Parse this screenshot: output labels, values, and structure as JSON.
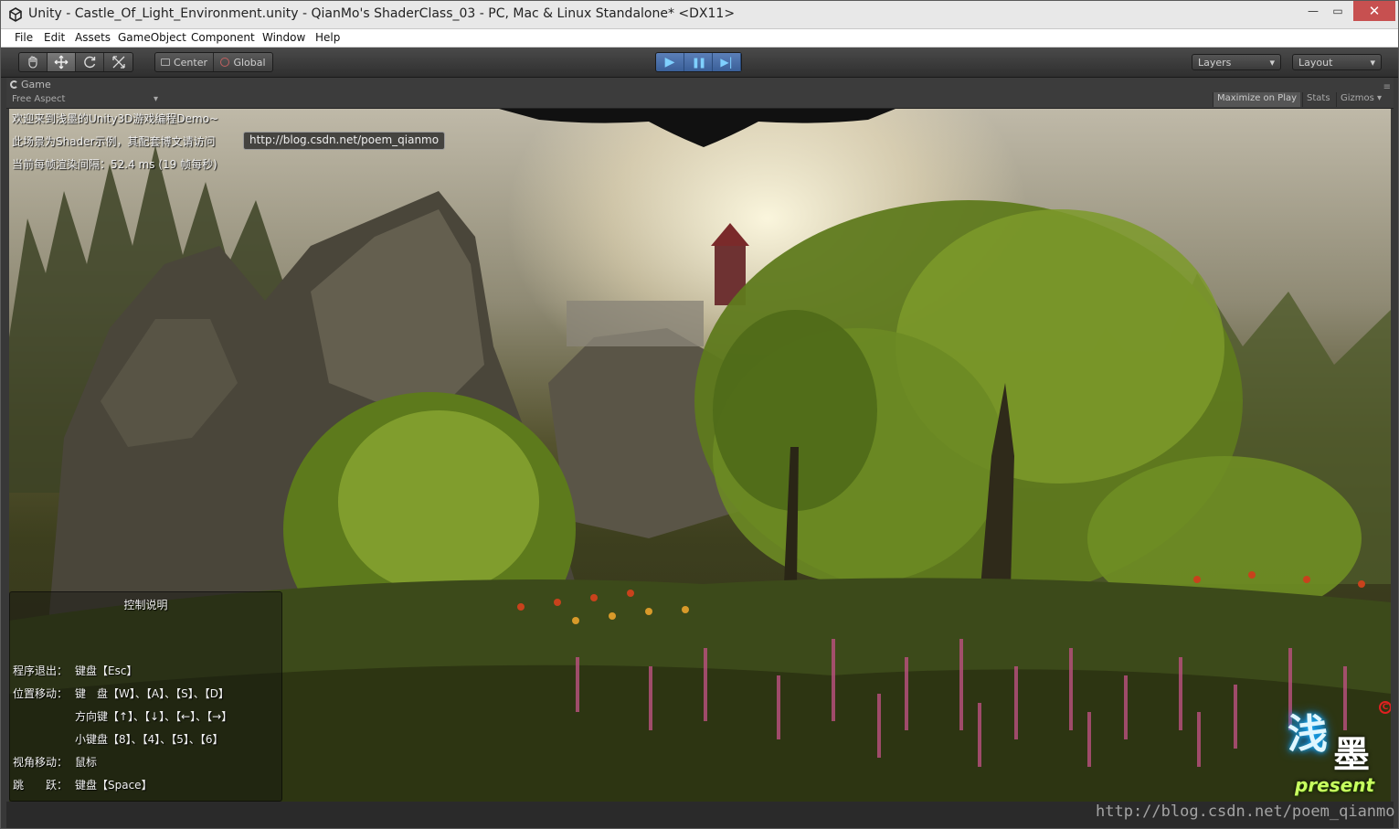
{
  "window": {
    "title": "Unity - Castle_Of_Light_Environment.unity - QianMo's ShaderClass_03 - PC, Mac & Linux Standalone* <DX11>",
    "minimize": "—",
    "maximize": "▭",
    "close": "✕"
  },
  "menu": [
    "File",
    "Edit",
    "Assets",
    "GameObject",
    "Component",
    "Window",
    "Help"
  ],
  "toolbar": {
    "tools": [
      "hand-icon",
      "move-icon",
      "rotate-icon",
      "scale-icon"
    ],
    "pivot": "Center",
    "space": "Global",
    "play": "▶",
    "pause": "❚❚",
    "step": "▶|",
    "layers": "Layers",
    "layout": "Layout",
    "dropdown_arrow": "▾"
  },
  "game_view": {
    "tab": "Game",
    "aspect": "Free Aspect",
    "maximize_on_play": "Maximize on Play",
    "stats": "Stats",
    "gizmos": "Gizmos"
  },
  "hud": {
    "welcome": "欢迎来到浅墨的Unity3D游戏编程Demo~",
    "shader_note": "此场景为Shader示例，其配套博文请访问",
    "url_button": "http://blog.csdn.net/poem_qianmo",
    "frame_time": "当前每帧渲染间隔：52.4 ms (19 帧每秒)"
  },
  "controls": {
    "title": "控制说明",
    "rows": [
      {
        "label": "程序退出：",
        "value": "键盘【Esc】"
      },
      {
        "label": "位置移动：",
        "value": "键　盘【W】、【A】、【S】、【D】"
      },
      {
        "label": "",
        "value": "方向键【↑】、【↓】、【←】、【→】"
      },
      {
        "label": "",
        "value": "小键盘【8】、【4】、【5】、【6】"
      },
      {
        "label": "视角移动：",
        "value": "鼠标"
      },
      {
        "label": "跳　　跃：",
        "value": "键盘【Space】"
      }
    ]
  },
  "logo": {
    "char1": "浅",
    "char2": "墨",
    "present": "present",
    "copyright": "C"
  },
  "watermark": "http://blog.csdn.net/poem_qianmo"
}
